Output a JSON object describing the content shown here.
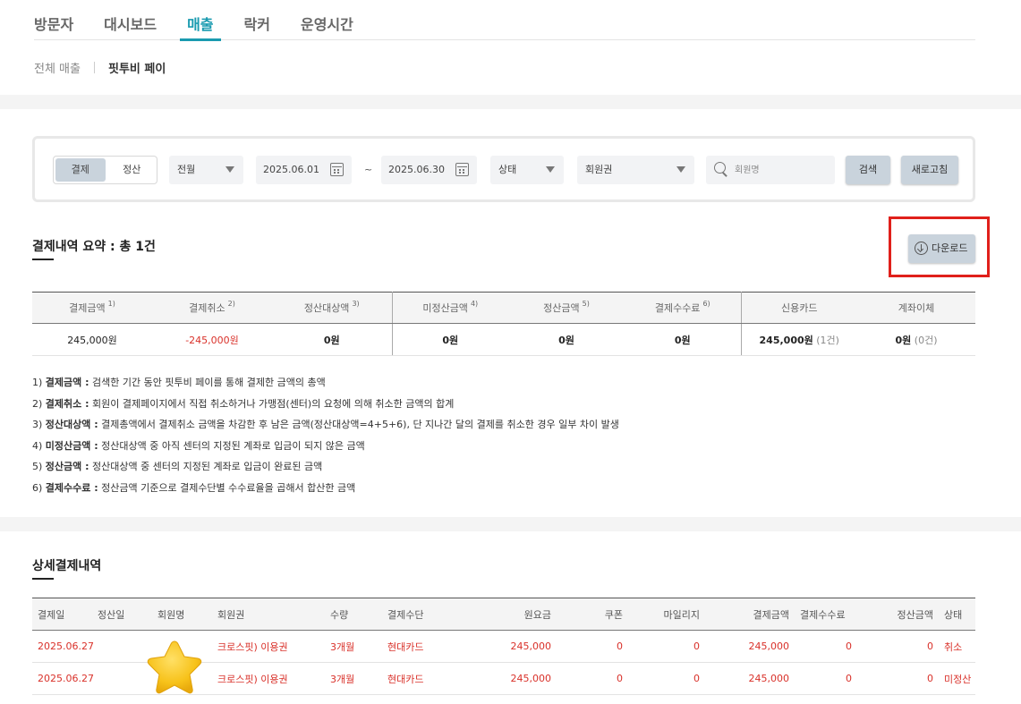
{
  "main_tabs": [
    {
      "label": "방문자",
      "active": false
    },
    {
      "label": "대시보드",
      "active": false
    },
    {
      "label": "매출",
      "active": true
    },
    {
      "label": "락커",
      "active": false
    },
    {
      "label": "운영시간",
      "active": false
    }
  ],
  "sub_tabs": [
    {
      "label": "전체 매출",
      "active": false
    },
    {
      "label": "핏투비 페이",
      "active": true
    }
  ],
  "filter": {
    "mode_options": [
      "결제",
      "정산"
    ],
    "mode_selected": "결제",
    "period": "전월",
    "date_from": "2025.06.01",
    "date_sep": "~",
    "date_to": "2025.06.30",
    "status": "상태",
    "membership": "회원권",
    "search_placeholder": "회원명",
    "search_label": "검색",
    "refresh_label": "새로고침"
  },
  "summary": {
    "title": "결제내역 요약 : 총 1건",
    "download_label": "다운로드",
    "headers": [
      {
        "label": "결제금액",
        "sup": "1)"
      },
      {
        "label": "결제취소",
        "sup": "2)"
      },
      {
        "label": "정산대상액",
        "sup": "3)"
      },
      {
        "label": "미정산금액",
        "sup": "4)"
      },
      {
        "label": "정산금액",
        "sup": "5)"
      },
      {
        "label": "결제수수료",
        "sup": "6)"
      },
      {
        "label": "신용카드",
        "sup": ""
      },
      {
        "label": "계좌이체",
        "sup": ""
      }
    ],
    "values": {
      "payment": "245,000원",
      "cancel": "-245,000원",
      "settle_target": "0원",
      "unsettled": "0원",
      "settled": "0원",
      "fee": "0원",
      "card_amount": "245,000원",
      "card_count": "(1건)",
      "transfer_amount": "0원",
      "transfer_count": "(0건)"
    }
  },
  "notes": [
    {
      "num": "1)",
      "term": "결제금액 :",
      "desc": "검색한 기간 동안 핏투비 페이를 통해 결제한 금액의 총액"
    },
    {
      "num": "2)",
      "term": "결제취소 :",
      "desc": "회원이 결제페이지에서 직접 취소하거나 가맹점(센터)의 요청에 의해 취소한 금액의 합계"
    },
    {
      "num": "3)",
      "term": "정산대상액 :",
      "desc": "결제총액에서 결제취소 금액을 차감한 후 남은 금액(정산대상액=4+5+6), 단 지나간 달의 결제를 취소한 경우 일부 차이 발생"
    },
    {
      "num": "4)",
      "term": "미정산금액 :",
      "desc": "정산대상액 중 아직 센터의 지정된 계좌로 입금이 되지 않은 금액"
    },
    {
      "num": "5)",
      "term": "정산금액 :",
      "desc": "정산대상액 중 센터의 지정된 계좌로 입금이 완료된 금액"
    },
    {
      "num": "6)",
      "term": "결제수수료 :",
      "desc": "정산금액 기준으로 결제수단별 수수료율을 곱해서 합산한 금액"
    }
  ],
  "detail": {
    "title": "상세결제내역",
    "headers": [
      "결제일",
      "정산일",
      "회원명",
      "회원권",
      "수량",
      "결제수단",
      "원요금",
      "쿠폰",
      "마일리지",
      "결제금액",
      "결제수수료",
      "정산금액",
      "상태"
    ],
    "rows": [
      [
        "2025.06.27",
        "",
        "",
        "크로스핏) 이용권",
        "3개월",
        "현대카드",
        "245,000",
        "0",
        "0",
        "245,000",
        "0",
        "0",
        "취소"
      ],
      [
        "2025.06.27",
        "",
        "",
        "크로스핏) 이용권",
        "3개월",
        "현대카드",
        "245,000",
        "0",
        "0",
        "245,000",
        "0",
        "0",
        "미정산"
      ]
    ]
  },
  "colors": {
    "accent": "#1a9bb0",
    "red_text": "#d9312a",
    "highlight_border": "#e0201b",
    "button_bg": "#c9d3dc"
  }
}
